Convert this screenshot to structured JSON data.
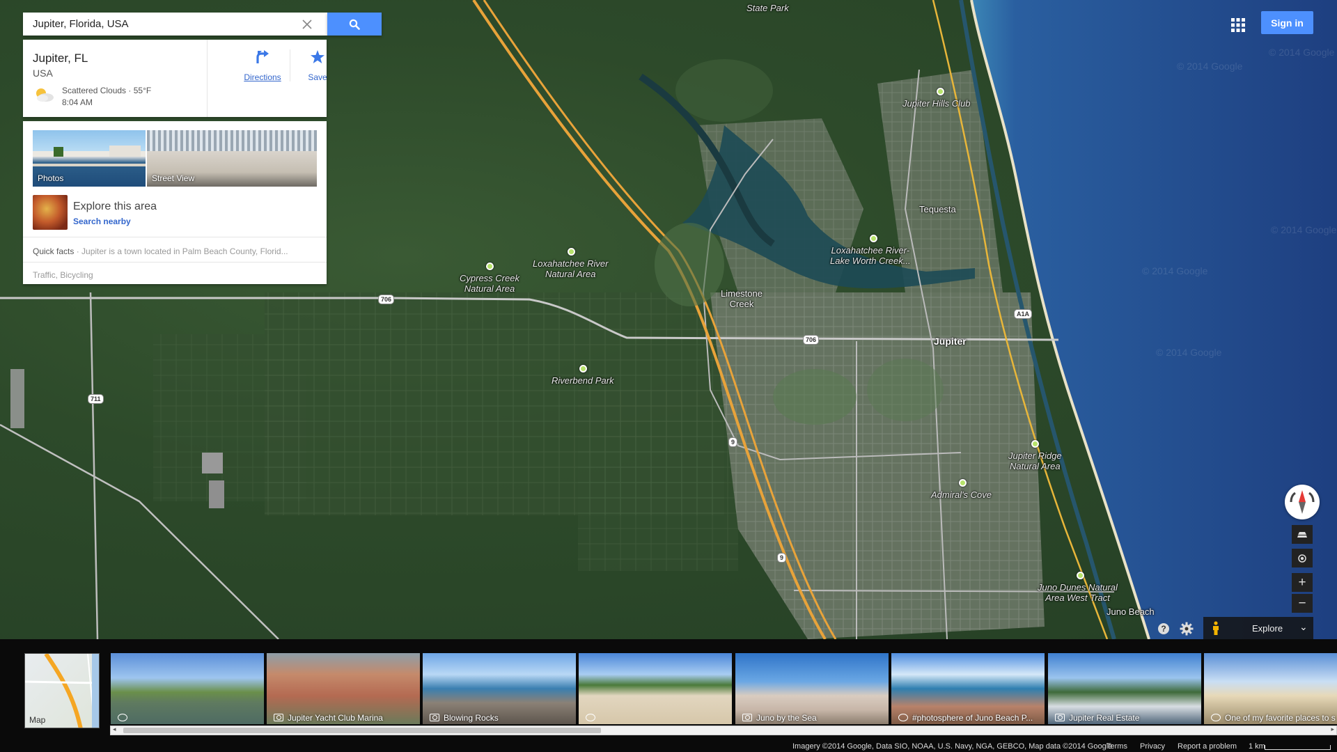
{
  "search": {
    "value": "Jupiter, Florida, USA",
    "clear_icon": "close-icon",
    "search_icon": "search-icon"
  },
  "place": {
    "name": "Jupiter, FL",
    "country": "USA",
    "weather": "Scattered Clouds · 55°F",
    "weather_time": "8:04 AM",
    "weather_icon": "partly-cloudy-icon",
    "actions": {
      "directions": "Directions",
      "save": "Save"
    }
  },
  "media": {
    "photos_label": "Photos",
    "street_view_label": "Street View",
    "explore_title": "Explore this area",
    "explore_link": "Search nearby",
    "quick_facts_label": "Quick facts",
    "quick_facts_text": " · Jupiter is a town located in Palm Beach County, Florid...",
    "layers": "Traffic, Bicycling"
  },
  "header": {
    "apps_icon": "apps-grid-icon",
    "signin_label": "Sign in"
  },
  "map": {
    "poi_labels": {
      "state_park": "State Park",
      "jupiter_hills": "Jupiter Hills Club",
      "tequesta": "Tequesta",
      "loxahatchee_lake": "Loxahatchee River-\nLake Worth Creek...",
      "cypress": "Cypress Creek\nNatural Area",
      "loxahatchee_natural": "Loxahatchee River\nNatural Area",
      "limestone": "Limestone\nCreek",
      "jupiter": "Jupiter",
      "riverbend": "Riverbend Park",
      "jupiter_ridge": "Jupiter Ridge\nNatural Area",
      "admirals_cove": "Admiral's Cove",
      "juno_dunes": "Juno Dunes Natural\nArea West Tract",
      "juno_beach": "Juno Beach"
    },
    "route_shields": {
      "r706_west": "706",
      "r711": "711",
      "r706_east": "706",
      "a1a": "A1A",
      "r9_north": "9",
      "r9_south": "9"
    },
    "watermark": "© 2014 Google",
    "colors": {
      "ocean": "#1f4a8a",
      "land": "#2d4a2a",
      "highway": "#e8a33a"
    }
  },
  "controls": {
    "compass_icon": "compass-icon",
    "tilt_icon": "tilt-icon",
    "location_icon": "my-location-icon",
    "zoom_in": "+",
    "zoom_out": "−",
    "help_icon": "help-icon",
    "settings_icon": "gear-icon",
    "explore_label": "Explore",
    "explore_chevron": "⌄"
  },
  "filmstrip": {
    "map_label": "Map",
    "photos": [
      {
        "caption": "",
        "icon": "pano"
      },
      {
        "caption": "Jupiter Yacht Club Marina",
        "icon": "photo"
      },
      {
        "caption": "Blowing Rocks",
        "icon": "photo"
      },
      {
        "caption": "",
        "icon": "pano"
      },
      {
        "caption": "Juno by the Sea",
        "icon": "photo"
      },
      {
        "caption": "#photosphere of Juno Beach P...",
        "icon": "pano"
      },
      {
        "caption": "Jupiter Real Estate",
        "icon": "photo"
      },
      {
        "caption": "One of my favorite places to s",
        "icon": "pano"
      }
    ],
    "scroll_left": "◂",
    "scroll_right": "▸"
  },
  "footer": {
    "attribution": "Imagery ©2014 Google, Data SIO, NOAA, U.S. Navy, NGA, GEBCO, Map data ©2014 Google",
    "terms": "Terms",
    "privacy": "Privacy",
    "report": "Report a problem",
    "scale": "1 km"
  }
}
